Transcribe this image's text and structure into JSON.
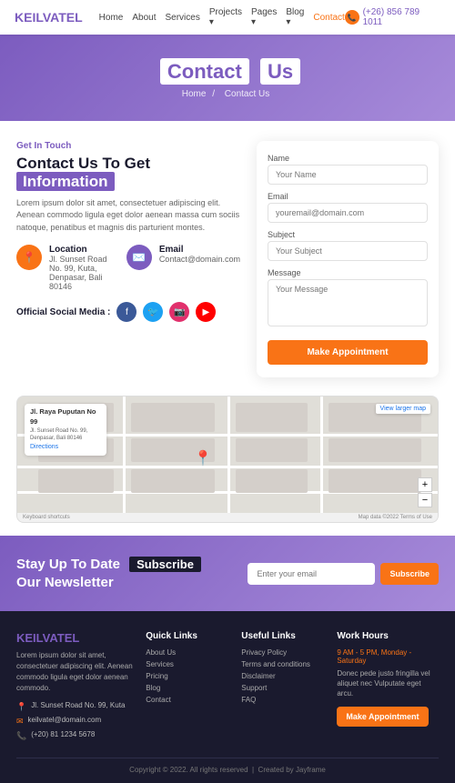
{
  "navbar": {
    "logo_prefix": "KEIL",
    "logo_suffix": "VATEL",
    "links": [
      {
        "label": "Home",
        "active": false
      },
      {
        "label": "About",
        "active": false
      },
      {
        "label": "Services",
        "active": false
      },
      {
        "label": "Projects",
        "active": false,
        "dropdown": true
      },
      {
        "label": "Pages",
        "active": false,
        "dropdown": true
      },
      {
        "label": "Blog",
        "active": false,
        "dropdown": true
      },
      {
        "label": "Contact",
        "active": true
      }
    ],
    "phone": "(+26) 856 789 1011"
  },
  "hero": {
    "title_1": "Contact",
    "title_2": "Us",
    "breadcrumb_home": "Home",
    "breadcrumb_current": "Contact Us"
  },
  "contact": {
    "get_in_touch": "Get In Touch",
    "title_line1": "Contact Us To Get",
    "title_highlight": "Information",
    "description": "Lorem ipsum dolor sit amet, consectetuer adipiscing elit. Aenean commodo ligula eget dolor aenean massa cum sociis natoque, penatibus et magnis dis parturient montes.",
    "location_label": "Location",
    "location_value": "Jl. Sunset Road No. 99, Kuta, Denpasar, Bali 80146",
    "email_label": "Email",
    "email_value": "Contact@domain.com",
    "social_label": "Official Social Media :"
  },
  "form": {
    "name_label": "Name",
    "name_placeholder": "Your Name",
    "email_label": "Email",
    "email_placeholder": "youremail@domain.com",
    "subject_label": "Subject",
    "subject_placeholder": "Your Subject",
    "message_label": "Message",
    "message_placeholder": "Your Message",
    "submit_label": "Make Appointment"
  },
  "map": {
    "place_name": "Jl. Raya Puputan No 99",
    "place_detail": "Jl. Sunset Road No. 99, Denpasar, Bali 80146",
    "directions_label": "Directions",
    "view_larger": "View larger map",
    "copyright": "Map data ©2022 Terms of Use",
    "keyboard_shortcuts": "Keyboard shortcuts"
  },
  "newsletter": {
    "line1": "Stay Up To Date",
    "badge": "Subscribe",
    "line2": "Our Newsletter",
    "placeholder": "Enter your email",
    "btn_label": "Subscribe"
  },
  "footer": {
    "logo_prefix": "KEIL",
    "logo_suffix": "VATEL",
    "description": "Lorem ipsum dolor sit amet, consectetuer adipiscing elit. Aenean commodo ligula eget dolor aenean commodo.",
    "address": "Jl. Sunset Road No. 99, Kuta",
    "email": "keilvatel@domain.com",
    "phone": "(+20) 81 1234 5678",
    "quick_links_title": "Quick Links",
    "quick_links": [
      "About Us",
      "Services",
      "Pricing",
      "Blog",
      "Contact"
    ],
    "useful_links_title": "Useful Links",
    "useful_links": [
      "Privacy Policy",
      "Terms and conditions",
      "Disclaimer",
      "Support",
      "FAQ"
    ],
    "work_hours_title": "Work Hours",
    "work_hours_time": "9 AM - 5 PM, Monday - Saturday",
    "work_hours_desc": "Donec pede justo fringilla vel aliquet nec Vulputate eget arcu.",
    "appointment_btn": "Make Appointment",
    "copyright": "Copyright © 2022. All rights reserved",
    "credit": "Created by Jayframe"
  }
}
